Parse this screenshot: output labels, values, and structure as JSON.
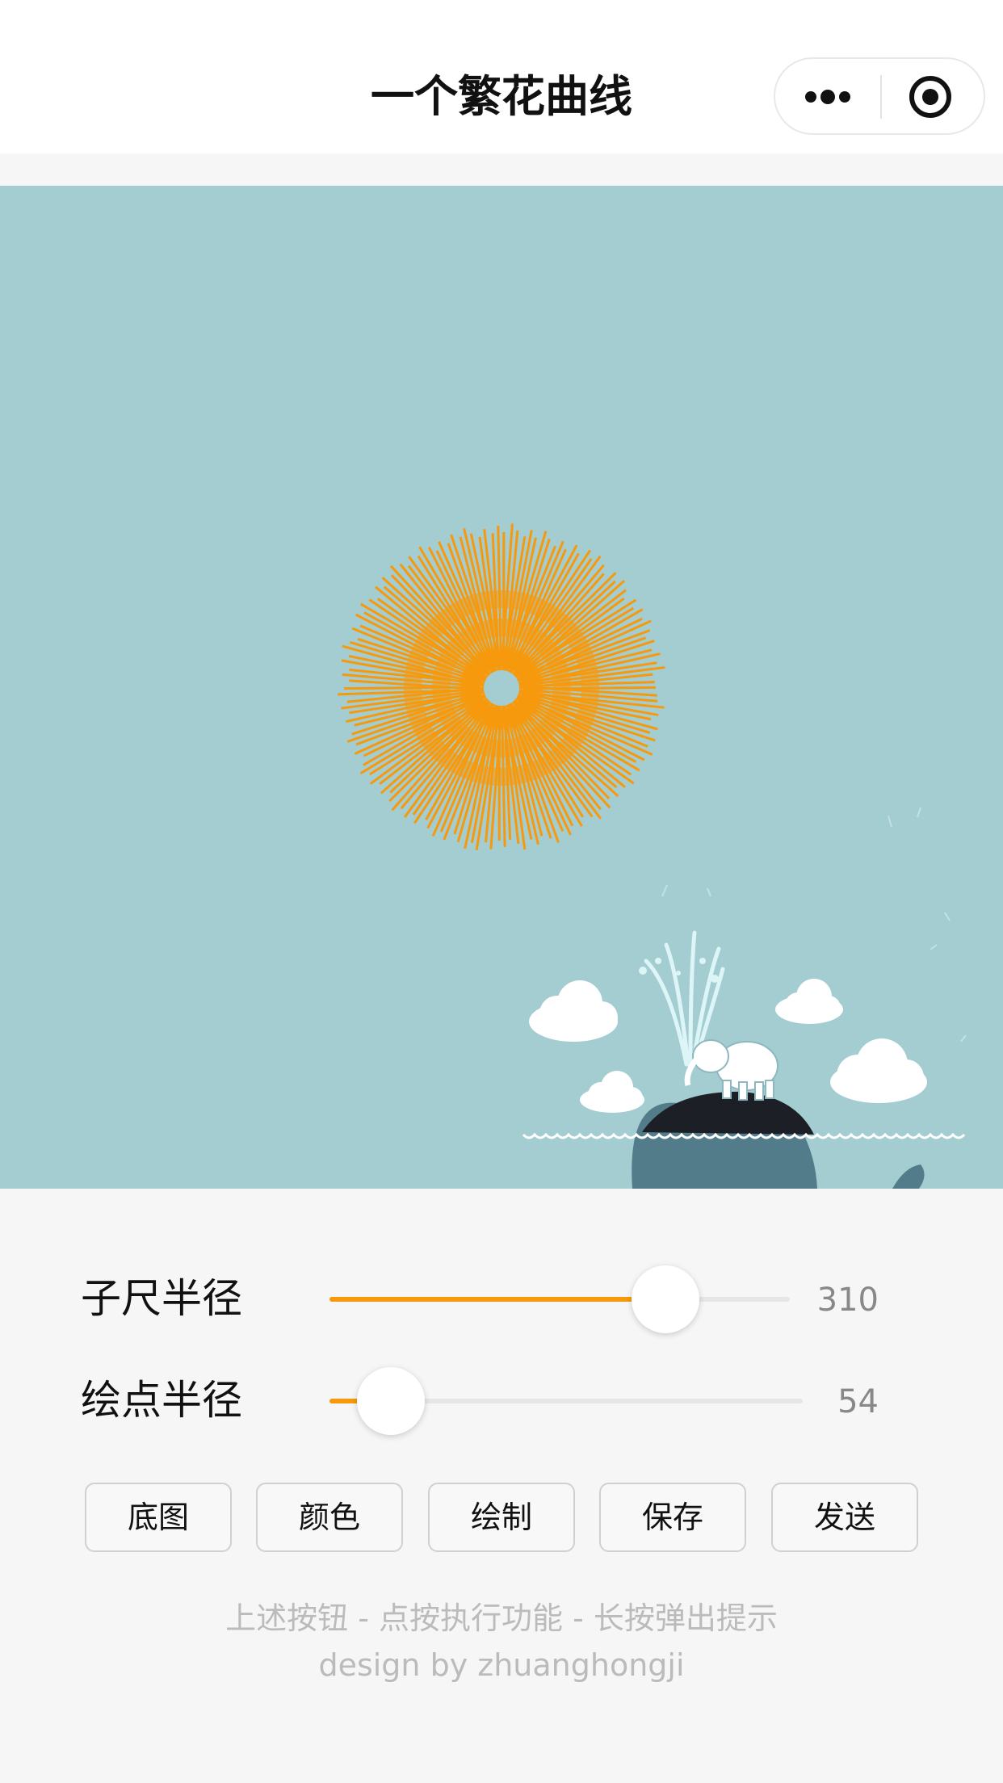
{
  "navbar": {
    "title": "一个繁花曲线",
    "more_icon": "ellipsis-icon",
    "close_icon": "target-circle-icon"
  },
  "canvas": {
    "background_color": "#a3cdd1",
    "curve_color": "#f7990c",
    "illustration": "whale-and-elephant-fountain"
  },
  "sliders": [
    {
      "label": "子尺半径",
      "value": "310",
      "fraction": 0.73
    },
    {
      "label": "绘点半径",
      "value": "54",
      "fraction": 0.13
    }
  ],
  "buttons": [
    {
      "label": "底图"
    },
    {
      "label": "颜色"
    },
    {
      "label": "绘制"
    },
    {
      "label": "保存"
    },
    {
      "label": "发送"
    }
  ],
  "footer": {
    "hint": "上述按钮 - 点按执行功能 - 长按弹出提示",
    "credit": "design by zhuanghongji"
  },
  "colors": {
    "accent": "#f7990c",
    "page_bg": "#f6f6f6"
  }
}
